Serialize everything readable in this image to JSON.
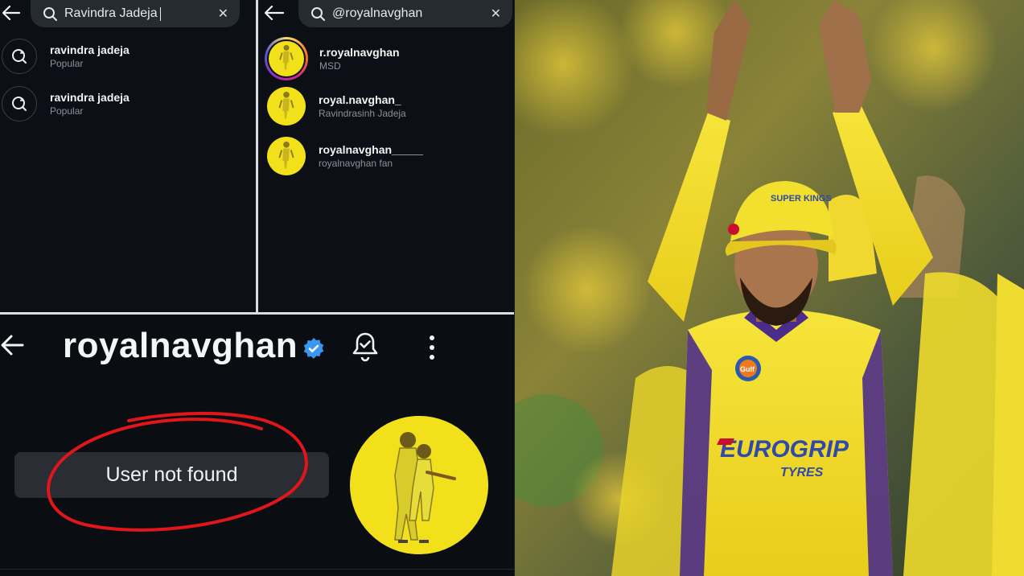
{
  "search_panel_1": {
    "query": "Ravindra Jadeja",
    "suggestions": [
      {
        "title": "ravindra jadeja",
        "subtitle": "Popular"
      },
      {
        "title": "ravindra jadeja",
        "subtitle": "Popular"
      }
    ]
  },
  "search_panel_2": {
    "query": "@royalnavghan",
    "accounts": [
      {
        "username": "r.royalnavghan",
        "name": "MSD"
      },
      {
        "username": "royal.navghan_",
        "name": "Ravindrasinh Jadeja"
      },
      {
        "username": "royalnavghan_____",
        "name": "royalnavghan fan"
      }
    ]
  },
  "profile": {
    "username": "royalnavghan",
    "toast": "User not found"
  },
  "photo": {
    "jersey_text": "EUROGRIP",
    "jersey_sub": "TYRES",
    "cap_text": "SUPER KINGS",
    "badge_text": "Gulf"
  },
  "colors": {
    "accent_yellow": "#f2e01a",
    "verified_blue": "#3897f0",
    "annotation_red": "#e0161b",
    "jersey_purple": "#4b2c8a"
  },
  "icons": {
    "back": "arrow-left-icon",
    "search": "search-refresh-icon",
    "clear": "close-icon",
    "verified": "verified-badge-icon",
    "notify": "bell-check-icon",
    "more": "more-vertical-icon"
  }
}
